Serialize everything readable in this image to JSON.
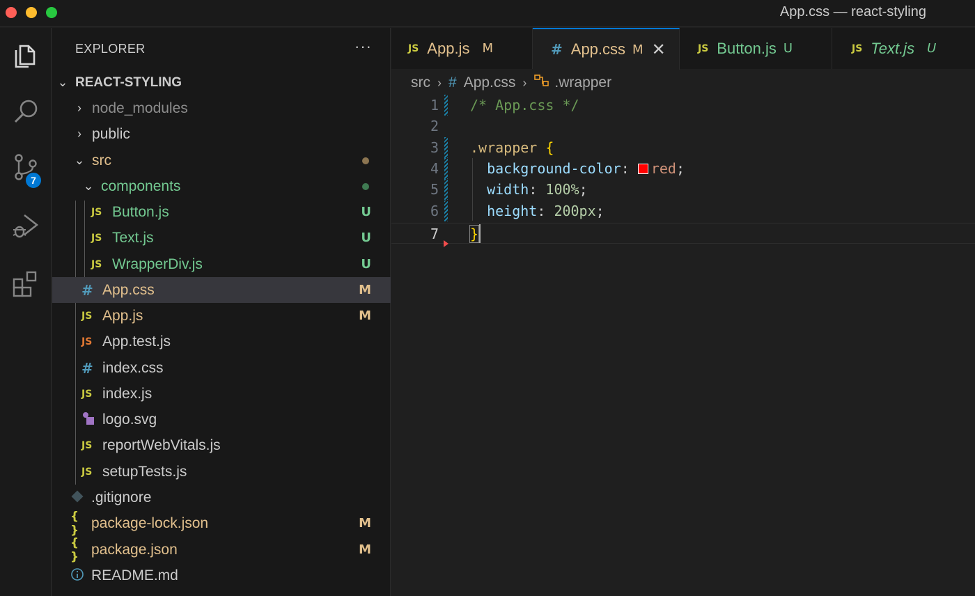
{
  "window": {
    "title": "App.css — react-styling"
  },
  "activity_bar": {
    "items": [
      {
        "name": "explorer",
        "icon": "files-icon"
      },
      {
        "name": "search",
        "icon": "search-icon"
      },
      {
        "name": "source-control",
        "icon": "source-control-icon",
        "badge": "7"
      },
      {
        "name": "run-and-debug",
        "icon": "debug-icon"
      },
      {
        "name": "extensions",
        "icon": "extensions-icon"
      }
    ]
  },
  "sidebar": {
    "header": "EXPLORER",
    "more": "···",
    "root": "REACT-STYLING",
    "items": [
      {
        "label": "node_modules",
        "type": "folder",
        "expanded": false,
        "status": ""
      },
      {
        "label": "public",
        "type": "folder",
        "expanded": false,
        "status": ""
      },
      {
        "label": "src",
        "type": "folder",
        "expanded": true,
        "status": "dot"
      },
      {
        "label": "components",
        "type": "folder",
        "expanded": true,
        "status": "dot"
      },
      {
        "label": "Button.js",
        "icon": "JS",
        "status": "U"
      },
      {
        "label": "Text.js",
        "icon": "JS",
        "status": "U"
      },
      {
        "label": "WrapperDiv.js",
        "icon": "JS",
        "status": "U"
      },
      {
        "label": "App.css",
        "icon": "#",
        "status": "M"
      },
      {
        "label": "App.js",
        "icon": "JS",
        "status": "M"
      },
      {
        "label": "App.test.js",
        "icon": "JS",
        "status": ""
      },
      {
        "label": "index.css",
        "icon": "#",
        "status": ""
      },
      {
        "label": "index.js",
        "icon": "JS",
        "status": ""
      },
      {
        "label": "logo.svg",
        "icon": "svg",
        "status": ""
      },
      {
        "label": "reportWebVitals.js",
        "icon": "JS",
        "status": ""
      },
      {
        "label": "setupTests.js",
        "icon": "JS",
        "status": ""
      },
      {
        "label": ".gitignore",
        "icon": "git",
        "status": ""
      },
      {
        "label": "package-lock.json",
        "icon": "{ }",
        "status": "M"
      },
      {
        "label": "package.json",
        "icon": "{ }",
        "status": "M"
      },
      {
        "label": "README.md",
        "icon": "info",
        "status": ""
      }
    ]
  },
  "tabs": [
    {
      "icon": "JS",
      "label": "App.js",
      "status": "M",
      "active": false
    },
    {
      "icon": "#",
      "label": "App.css",
      "status": "M",
      "active": true
    },
    {
      "icon": "JS",
      "label": "Button.js",
      "status": "U",
      "active": false
    },
    {
      "icon": "JS",
      "label": "Text.js",
      "status": "U",
      "active": false
    }
  ],
  "breadcrumb": {
    "folder": "src",
    "file_icon": "#",
    "file": "App.css",
    "symbol": ".wrapper"
  },
  "editor": {
    "line_numbers": [
      "1",
      "2",
      "3",
      "4",
      "5",
      "6",
      "7"
    ],
    "lines": {
      "l1": "/* App.css */",
      "l3_selector": ".wrapper",
      "l3_brace": "{",
      "l4_prop": "background-color",
      "l4_value": "red",
      "l5_prop": "width",
      "l5_value": "100%",
      "l6_prop": "height",
      "l6_value": "200px",
      "l7_brace": "}",
      "colon": ":",
      "semicolon": ";"
    }
  },
  "colors": {
    "accent": "#0078d4",
    "modified": "#e2c08d",
    "untracked": "#73c991",
    "js_icon": "#cbcb41",
    "css_icon": "#519aba"
  }
}
